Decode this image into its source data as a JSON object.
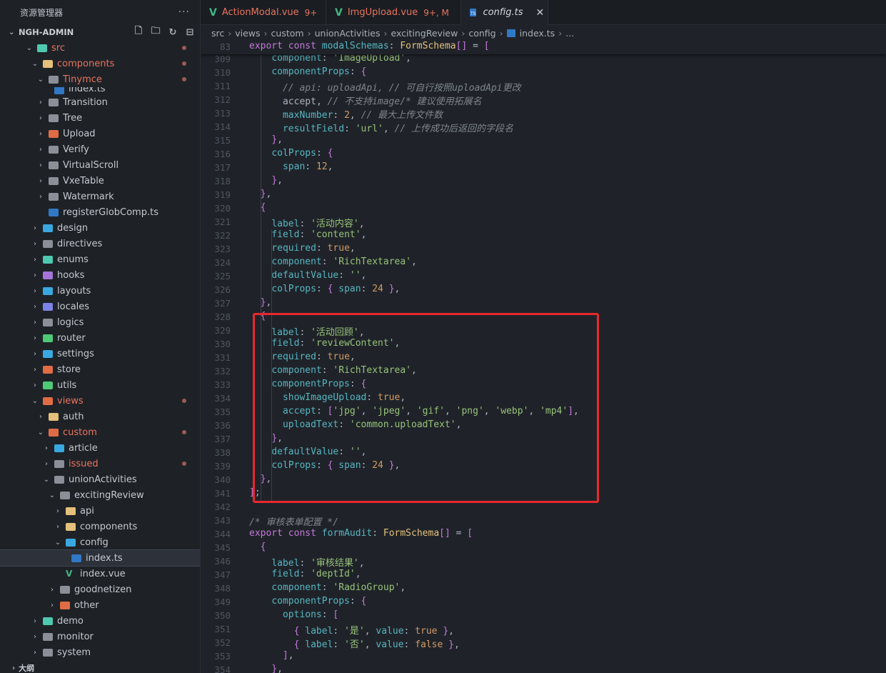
{
  "sidebar": {
    "title": "资源管理器",
    "more": "···",
    "project": "NGH-ADMIN",
    "tree": [
      {
        "label": "src",
        "depth": 0,
        "open": true,
        "color": "#4ec9b0",
        "mod": true,
        "dot": true
      },
      {
        "label": "components",
        "depth": 1,
        "open": true,
        "color": "#e5c07b",
        "mod": true,
        "dot": true
      },
      {
        "label": "Tinymce",
        "depth": 2,
        "open": true,
        "color": "#8a8f98",
        "mod": true,
        "dot": true
      },
      {
        "label": "index.ts",
        "depth": 3,
        "leaf": true,
        "color": "#3178c6",
        "partial": true
      },
      {
        "label": "Transition",
        "depth": 2,
        "color": "#8a8f98"
      },
      {
        "label": "Tree",
        "depth": 2,
        "color": "#8a8f98"
      },
      {
        "label": "Upload",
        "depth": 2,
        "color": "#e06c45"
      },
      {
        "label": "Verify",
        "depth": 2,
        "color": "#8a8f98"
      },
      {
        "label": "VirtualScroll",
        "depth": 2,
        "color": "#8a8f98"
      },
      {
        "label": "VxeTable",
        "depth": 2,
        "color": "#8a8f98"
      },
      {
        "label": "Watermark",
        "depth": 2,
        "color": "#8a8f98"
      },
      {
        "label": "registerGlobComp.ts",
        "depth": 2,
        "leaf": true,
        "color": "#3178c6"
      },
      {
        "label": "design",
        "depth": 1,
        "color": "#3aa8e0"
      },
      {
        "label": "directives",
        "depth": 1,
        "color": "#8a8f98"
      },
      {
        "label": "enums",
        "depth": 1,
        "color": "#4ec9b0"
      },
      {
        "label": "hooks",
        "depth": 1,
        "color": "#a674d8"
      },
      {
        "label": "layouts",
        "depth": 1,
        "color": "#3aa8e0"
      },
      {
        "label": "locales",
        "depth": 1,
        "color": "#7c83e8"
      },
      {
        "label": "logics",
        "depth": 1,
        "color": "#8a8f98"
      },
      {
        "label": "router",
        "depth": 1,
        "color": "#4ec976"
      },
      {
        "label": "settings",
        "depth": 1,
        "color": "#3aa8e0"
      },
      {
        "label": "store",
        "depth": 1,
        "color": "#e06c45"
      },
      {
        "label": "utils",
        "depth": 1,
        "color": "#4ec976"
      },
      {
        "label": "views",
        "depth": 1,
        "open": true,
        "color": "#e06c45",
        "mod": true,
        "dot": true
      },
      {
        "label": "auth",
        "depth": 2,
        "color": "#e5c07b"
      },
      {
        "label": "custom",
        "depth": 2,
        "open": true,
        "color": "#e06c45",
        "mod": true,
        "dot": true
      },
      {
        "label": "article",
        "depth": 3,
        "color": "#3aa8e0"
      },
      {
        "label": "issued",
        "depth": 3,
        "color": "#8a8f98",
        "mod": true,
        "dot": true
      },
      {
        "label": "unionActivities",
        "depth": 3,
        "open": true,
        "color": "#8a8f98"
      },
      {
        "label": "excitingReview",
        "depth": 4,
        "open": true,
        "color": "#8a8f98"
      },
      {
        "label": "api",
        "depth": 5,
        "color": "#e5c07b"
      },
      {
        "label": "components",
        "depth": 5,
        "color": "#e5c07b"
      },
      {
        "label": "config",
        "depth": 5,
        "open": true,
        "color": "#3aa8e0"
      },
      {
        "label": "index.ts",
        "depth": 6,
        "leaf": true,
        "color": "#3178c6",
        "active": true
      },
      {
        "label": "index.vue",
        "depth": 5,
        "leaf": true,
        "color": "#41b883",
        "vue": true
      },
      {
        "label": "goodnetizen",
        "depth": 4,
        "color": "#8a8f98"
      },
      {
        "label": "other",
        "depth": 4,
        "color": "#e06c45"
      },
      {
        "label": "demo",
        "depth": 1,
        "color": "#4ec9b0"
      },
      {
        "label": "monitor",
        "depth": 1,
        "color": "#8a8f98"
      },
      {
        "label": "system",
        "depth": 1,
        "color": "#8a8f98"
      }
    ],
    "outline": "大纲"
  },
  "tabs": [
    {
      "label": "ActionModal.vue",
      "badge": "9+",
      "kind": "vue"
    },
    {
      "label": "ImgUpload.vue",
      "badge": "9+, M",
      "kind": "vue"
    },
    {
      "label": "config.ts",
      "kind": "ts",
      "active": true,
      "close": "✕"
    }
  ],
  "breadcrumbs": [
    "src",
    "views",
    "custom",
    "unionActivities",
    "excitingReview",
    "config",
    "index.ts",
    "..."
  ],
  "editor": {
    "sticky": {
      "num": "83",
      "html": "<span class='kw'>export const</span> <span class='pr'>modalSchemas</span><span class='pu'>:</span> <span class='ty'>FormSchema</span><span class='br2'>[]</span> <span class='pu'>=</span> <span class='br2'>[</span>"
    },
    "lines": [
      {
        "n": "309",
        "t": "    component: 'ImageUpload',"
      },
      {
        "n": "310",
        "t": "    componentProps: {"
      },
      {
        "n": "311",
        "t": "      // api: uploadApi, // 可自行按照uploadApi更改"
      },
      {
        "n": "312",
        "t": "      accept, // 不支持image/* 建议使用拓展名"
      },
      {
        "n": "313",
        "t": "      maxNumber: 2, // 最大上传文件数"
      },
      {
        "n": "314",
        "t": "      resultField: 'url', // 上传成功后返回的字段名"
      },
      {
        "n": "315",
        "t": "    },"
      },
      {
        "n": "316",
        "t": "    colProps: {"
      },
      {
        "n": "317",
        "t": "      span: 12,"
      },
      {
        "n": "318",
        "t": "    },"
      },
      {
        "n": "319",
        "t": "  },"
      },
      {
        "n": "320",
        "t": "  {"
      },
      {
        "n": "321",
        "t": "    label: '活动内容',"
      },
      {
        "n": "322",
        "t": "    field: 'content',"
      },
      {
        "n": "323",
        "t": "    required: true,"
      },
      {
        "n": "324",
        "t": "    component: 'RichTextarea',"
      },
      {
        "n": "325",
        "t": "    defaultValue: '',"
      },
      {
        "n": "326",
        "t": "    colProps: { span: 24 },"
      },
      {
        "n": "327",
        "t": "  },"
      },
      {
        "n": "328",
        "t": "  {"
      },
      {
        "n": "329",
        "t": "    label: '活动回顾',"
      },
      {
        "n": "330",
        "t": "    field: 'reviewContent',"
      },
      {
        "n": "331",
        "t": "    required: true,"
      },
      {
        "n": "332",
        "t": "    component: 'RichTextarea',"
      },
      {
        "n": "333",
        "t": "    componentProps: {"
      },
      {
        "n": "334",
        "t": "      showImageUpload: true,"
      },
      {
        "n": "335",
        "t": "      accept: ['jpg', 'jpeg', 'gif', 'png', 'webp', 'mp4'],"
      },
      {
        "n": "336",
        "t": "      uploadText: 'common.uploadText',"
      },
      {
        "n": "337",
        "t": "    },"
      },
      {
        "n": "338",
        "t": "    defaultValue: '',"
      },
      {
        "n": "339",
        "t": "    colProps: { span: 24 },"
      },
      {
        "n": "340",
        "t": "  },"
      },
      {
        "n": "341",
        "t": "];"
      },
      {
        "n": "342",
        "t": ""
      },
      {
        "n": "343",
        "t": "/* 审核表单配置 */"
      },
      {
        "n": "344",
        "t": "export const formAudit: FormSchema[] = ["
      },
      {
        "n": "345",
        "t": "  {"
      },
      {
        "n": "346",
        "t": "    label: '审核结果',"
      },
      {
        "n": "347",
        "t": "    field: 'deptId',"
      },
      {
        "n": "348",
        "t": "    component: 'RadioGroup',"
      },
      {
        "n": "349",
        "t": "    componentProps: {"
      },
      {
        "n": "350",
        "t": "      options: ["
      },
      {
        "n": "351",
        "t": "        { label: '是', value: true },"
      },
      {
        "n": "352",
        "t": "        { label: '否', value: false },"
      },
      {
        "n": "353",
        "t": "      ],"
      },
      {
        "n": "354",
        "t": "    },"
      }
    ]
  }
}
